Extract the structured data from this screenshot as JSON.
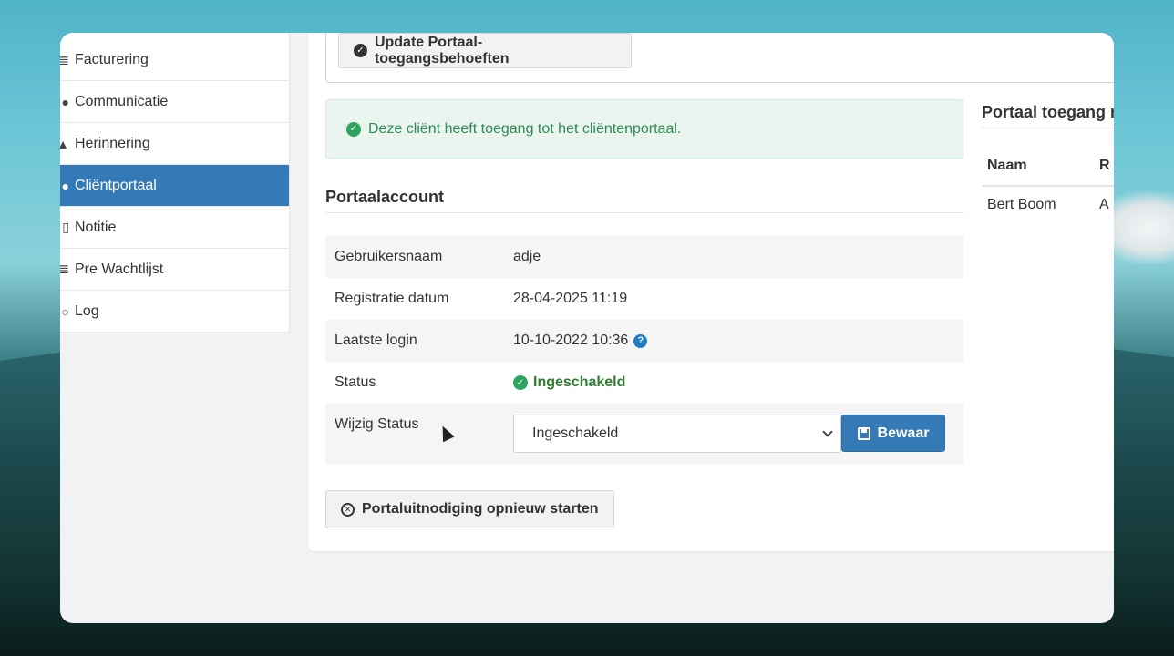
{
  "sidebar": {
    "items": [
      {
        "label": "Facturering",
        "icon": "list-icon",
        "active": false
      },
      {
        "label": "Communicatie",
        "icon": "chat-icon",
        "active": false
      },
      {
        "label": "Herinnering",
        "icon": "bell-icon",
        "active": false
      },
      {
        "label": "Cliëntportaal",
        "icon": "help-circle-icon",
        "active": true
      },
      {
        "label": "Notitie",
        "icon": "file-icon",
        "active": false
      },
      {
        "label": "Pre Wachtlijst",
        "icon": "list-icon",
        "active": false
      },
      {
        "label": "Log",
        "icon": "history-icon",
        "active": false
      }
    ]
  },
  "main": {
    "update_button": "Update Portaal-toegangsbehoeften",
    "alert_text": "Deze cliënt heeft toegang tot het cliëntenportaal.",
    "section_title": "Portaalaccount",
    "rows": [
      {
        "label": "Gebruikersnaam",
        "value": "adje"
      },
      {
        "label": "Registratie datum",
        "value": "28-04-2025 11:19"
      },
      {
        "label": "Laatste login",
        "value": "10-10-2022 10:36"
      },
      {
        "label": "Status",
        "value": "Ingeschakeld"
      }
    ],
    "edit_status_label": "Wijzig Status",
    "status_select_value": "Ingeschakeld",
    "save_button": "Bewaar",
    "restart_button": "Portaluitnodiging opnieuw starten"
  },
  "right": {
    "title": "Portaal toegang r",
    "headers": [
      "Naam",
      "R"
    ],
    "rows": [
      [
        "Bert Boom",
        "A"
      ]
    ]
  },
  "colors": {
    "accent": "#337ab7",
    "success": "#2ea55f",
    "success_text": "#2e7d32"
  }
}
